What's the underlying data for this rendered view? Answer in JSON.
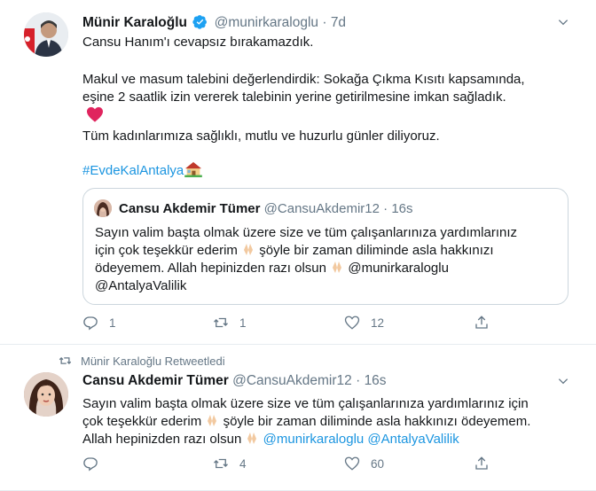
{
  "tweet1": {
    "author_name": "Münir Karaloğlu",
    "author_handle": "@munirkaraloglu",
    "separator": "·",
    "time": "7d",
    "para1": "Cansu Hanım'ı cevapsız bırakamazdık.",
    "para2_line1": "Makul ve masum talebini değerlendirdik: Sokağa Çıkma Kısıtı kapsamında,",
    "para2_line2": "eşine 2 saatlik izin vererek talebinin yerine getirilmesine imkan sağladık.",
    "para3": "Tüm kadınlarımıza sağlıklı, mutlu ve huzurlu günler diliyoruz.",
    "hashtag": "#EvdeKalAntalya",
    "heart_icon": "red-heart-icon",
    "house_icon": "house-icon",
    "quote": {
      "author_name": "Cansu Akdemir Tümer",
      "author_handle": "@CansuAkdemir12",
      "separator": "·",
      "time": "16s",
      "line1": "Sayın valim başta olmak üzere size ve tüm çalışanlarınıza  yardımlarınız",
      "line2_a": "için çok teşekkür ederim",
      "line2_b": "şöyle bir zaman diliminde asla hakkınızı",
      "line3_a": "ödeyemem. Allah hepinizden razı olsun",
      "line3_b": "@munirkaraloglu",
      "line4": "@AntalyaValilik"
    },
    "actions": {
      "reply_count": "1",
      "retweet_count": "1",
      "like_count": "12"
    }
  },
  "tweet2": {
    "retweeted_by": "Münir Karaloğlu Retweetledi",
    "author_name": "Cansu Akdemir Tümer",
    "author_handle": "@CansuAkdemir12",
    "separator": "·",
    "time": "16s",
    "line1": "Sayın valim başta olmak üzere size ve tüm çalışanlarınıza  yardımlarınız için",
    "line2_a": "çok teşekkür ederim",
    "line2_b": "şöyle bir zaman diliminde asla hakkınızı ödeyemem.",
    "line3_a": "Allah hepinizden razı olsun",
    "mention1": "@munirkaraloglu",
    "mention2": "@AntalyaValilik",
    "actions": {
      "reply_count": "",
      "retweet_count": "4",
      "like_count": "60"
    }
  },
  "colors": {
    "link": "#1b95e0",
    "muted": "#657786",
    "verified": "#1da1f2",
    "heart": "#e0245e",
    "border": "#e6ecf0"
  }
}
